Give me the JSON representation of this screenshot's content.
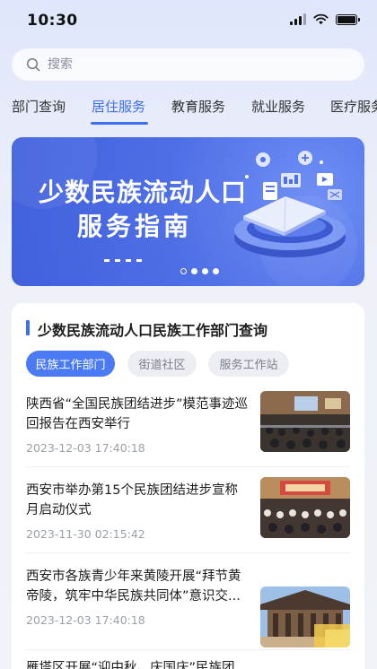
{
  "status_bar": {
    "time": "10:30"
  },
  "search": {
    "placeholder": "搜索"
  },
  "tabs": [
    {
      "label": "部门查询"
    },
    {
      "label": "居住服务"
    },
    {
      "label": "教育服务"
    },
    {
      "label": "就业服务"
    },
    {
      "label": "医疗服务"
    }
  ],
  "active_tab_index": 1,
  "banner": {
    "title": "少数民族流动人口",
    "subtitle": "服务指南",
    "slide_count": 4,
    "active_slide_index": 0
  },
  "section": {
    "title": "少数民族流动人口民族工作部门查询",
    "filters": [
      {
        "label": "民族工作部门"
      },
      {
        "label": "街道社区"
      },
      {
        "label": "服务工作站"
      }
    ],
    "active_filter_index": 0
  },
  "news": [
    {
      "title": "陕西省“全国民族团结进步”模范事迹巡回报告在西安举行",
      "time": "2023-12-03 17:40:18"
    },
    {
      "title": "西安市举办第15个民族团结进步宣称月启动仪式",
      "time": "2023-11-30 02:15:42"
    },
    {
      "title": "西安市各族青少年来黄陵开展“拜节黄帝陵，筑牢中华民族共同体”意识交...",
      "time": "2023-12-03 17:40:18"
    },
    {
      "title": "雁塔区开展“迎中秋、庆国庆”民族团",
      "time": ""
    }
  ],
  "colors": {
    "accent": "#3d6ef0",
    "banner": "#4f6fe6",
    "chip_active": "#4a7af4"
  },
  "icons": [
    "signal-icon",
    "wifi-icon",
    "battery-icon",
    "search-icon"
  ]
}
